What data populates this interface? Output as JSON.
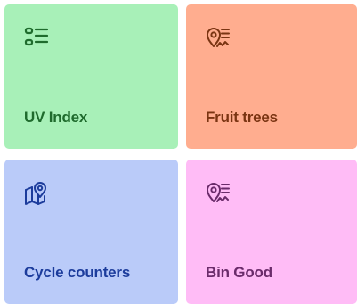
{
  "tiles": [
    {
      "label": "UV Index",
      "icon": "list-icon",
      "bg": "#a8f0b8",
      "fg": "#1f6b2d"
    },
    {
      "label": "Fruit trees",
      "icon": "map-pin-list-icon",
      "bg": "#ffad8f",
      "fg": "#7a3412"
    },
    {
      "label": "Cycle counters",
      "icon": "map-location-icon",
      "bg": "#bacbf9",
      "fg": "#1c3c9c"
    },
    {
      "label": "Bin Good",
      "icon": "map-pin-list-icon",
      "bg": "#ffbcf6",
      "fg": "#6a2b6a"
    }
  ]
}
